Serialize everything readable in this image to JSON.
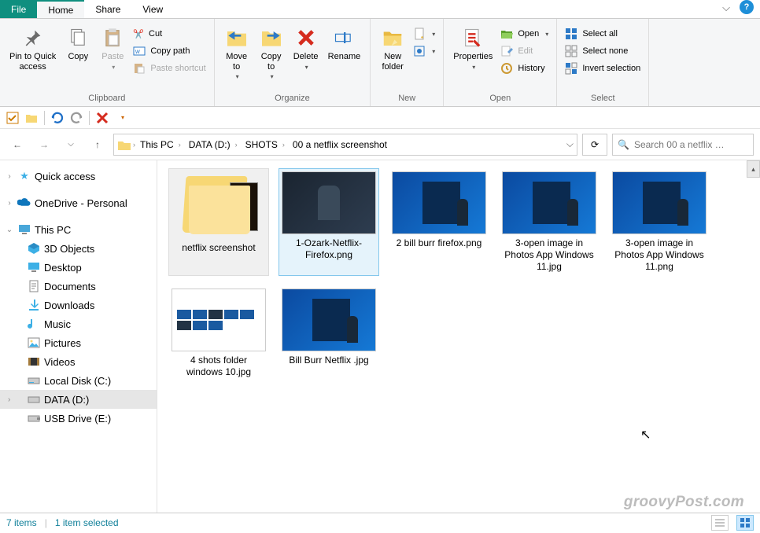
{
  "tabs": {
    "file": "File",
    "home": "Home",
    "share": "Share",
    "view": "View"
  },
  "ribbon": {
    "clipboard": {
      "label": "Clipboard",
      "pin": "Pin to Quick\naccess",
      "copy": "Copy",
      "paste": "Paste",
      "cut": "Cut",
      "copy_path": "Copy path",
      "paste_shortcut": "Paste shortcut"
    },
    "organize": {
      "label": "Organize",
      "move_to": "Move\nto",
      "copy_to": "Copy\nto",
      "delete": "Delete",
      "rename": "Rename"
    },
    "new": {
      "label": "New",
      "new_folder": "New\nfolder"
    },
    "open": {
      "label": "Open",
      "properties": "Properties",
      "open": "Open",
      "edit": "Edit",
      "history": "History"
    },
    "select": {
      "label": "Select",
      "select_all": "Select all",
      "select_none": "Select none",
      "invert": "Invert selection"
    }
  },
  "breadcrumbs": [
    "This PC",
    "DATA (D:)",
    "SHOTS",
    "00 a netflix screenshot"
  ],
  "search_placeholder": "Search 00 a netflix …",
  "tree": {
    "quick_access": "Quick access",
    "onedrive": "OneDrive - Personal",
    "this_pc": "This PC",
    "children": [
      "3D Objects",
      "Desktop",
      "Documents",
      "Downloads",
      "Music",
      "Pictures",
      "Videos",
      "Local Disk (C:)",
      "DATA (D:)",
      "USB Drive (E:)"
    ]
  },
  "items": [
    {
      "name": "netflix screenshot",
      "type": "folder"
    },
    {
      "name": "1-Ozark-Netflix-Firefox.png",
      "type": "image-dark",
      "selected": true
    },
    {
      "name": "2 bill burr firefox.png",
      "type": "image-blue"
    },
    {
      "name": "3-open image in Photos App Windows 11.jpg",
      "type": "image-blue"
    },
    {
      "name": "3-open image in Photos App Windows 11.png",
      "type": "image-blue"
    },
    {
      "name": "4 shots folder windows 10.jpg",
      "type": "image-white"
    },
    {
      "name": "Bill Burr Netflix .jpg",
      "type": "image-blue"
    }
  ],
  "status": {
    "count": "7 items",
    "selected": "1 item selected"
  },
  "watermark": "groovyPost.com"
}
